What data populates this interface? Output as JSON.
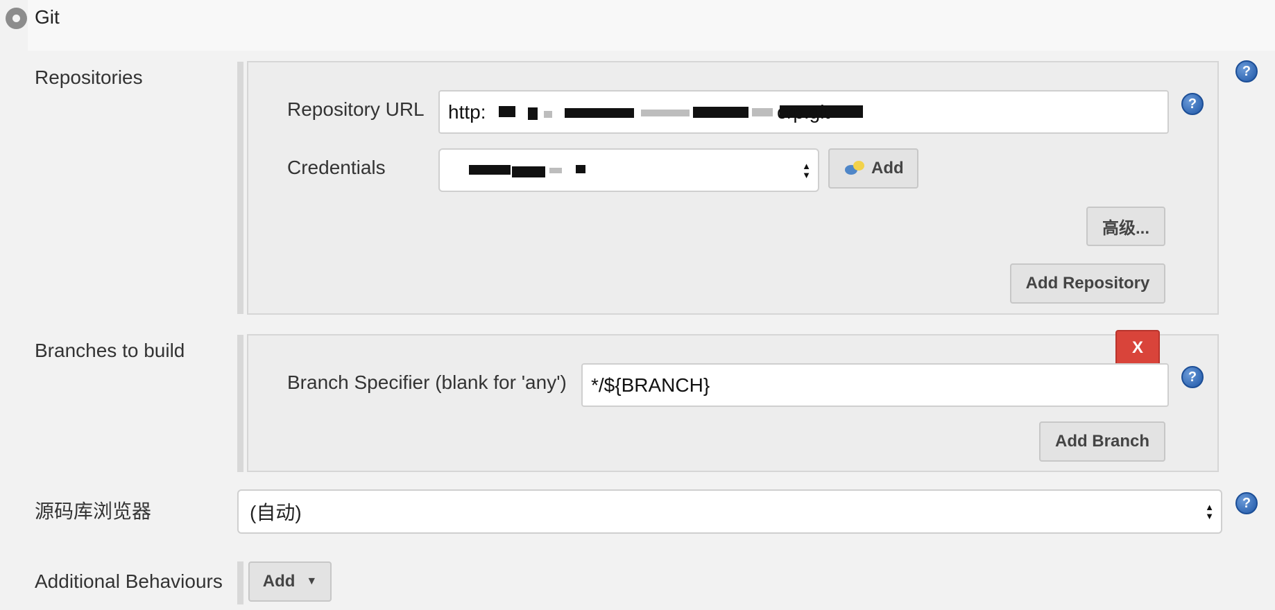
{
  "scm": {
    "option_label": "Git"
  },
  "repositories": {
    "label": "Repositories",
    "url_label": "Repository URL",
    "url_value": "http:",
    "url_suffix": "crp.git",
    "credentials_label": "Credentials",
    "add_label": "Add",
    "advanced_label": "高级...",
    "add_repository_label": "Add Repository"
  },
  "branches": {
    "label": "Branches to build",
    "delete_label": "X",
    "specifier_label": "Branch Specifier (blank for 'any')",
    "specifier_value": "*/${BRANCH}",
    "add_branch_label": "Add Branch"
  },
  "browser": {
    "label": "源码库浏览器",
    "selected": "(自动)"
  },
  "behaviours": {
    "label": "Additional Behaviours",
    "add_label": "Add"
  },
  "icons": {
    "help": "question-mark-help-icon",
    "radio": "radio-selected-icon",
    "credentials": "credentials-key-icon",
    "caret": "caret-down-icon"
  },
  "colors": {
    "delete_button": "#d9443a",
    "help_icon": "#2a63b5"
  }
}
